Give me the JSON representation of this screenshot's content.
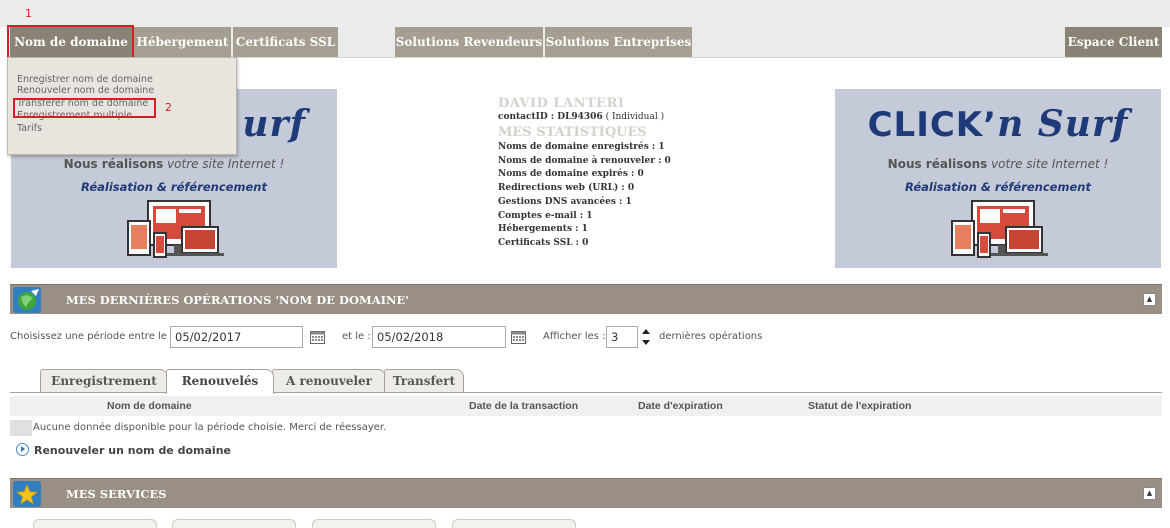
{
  "annotations": {
    "marker1": "1",
    "marker2": "2"
  },
  "nav": {
    "domain": "Nom de domaine",
    "hosting": "Hébergement",
    "ssl": "Certificats SSL",
    "resellers": "Solutions Revendeurs",
    "enterprise": "Solutions Entreprises",
    "client": "Espace Client"
  },
  "dropdown": {
    "items": [
      "Enregistrer nom de domaine",
      "Renouveler nom de domaine",
      "Transférer nom de domaine",
      "Enregistrement multiple",
      "Tarifs"
    ]
  },
  "banner": {
    "brand_main": "CLICK",
    "brand_apos": "’",
    "brand_italic": "n Surf",
    "tagline_bold": "Nous réalisons",
    "tagline_italic": " votre site Internet !",
    "subtag": "Réalisation & référencement",
    "left_visible_fragment": "urf"
  },
  "stats": {
    "name": "DAVID LANTERI",
    "contact_label": "contactID : ",
    "contact_id": "DL94306",
    "contact_type": " ( Individual )",
    "heading": "MES STATISTIQUES",
    "lines": [
      "Noms de domaine enregistrés : 1",
      "Noms de domaine à renouveler : 0",
      "Noms de domaine expirés : 0",
      "Redirections web (URL) : 0",
      "Gestions DNS avancées : 1",
      "Comptes e-mail : 1",
      "Hébergements : 1",
      "Certificats SSL : 0"
    ]
  },
  "operations": {
    "title": "MES DERNIÈRES OPÉRATIONS 'NOM DE DOMAINE'",
    "collapse_glyph": "▲",
    "period_label": "Choisissez une période entre le :",
    "date_from": "05/02/2017",
    "and_label": "et le :",
    "date_to": "05/02/2018",
    "show_label": "Afficher les :",
    "count": "3",
    "last_ops_label": "dernières opérations",
    "tabs": [
      "Enregistrement",
      "Renouvelés",
      "A renouveler",
      "Transfert"
    ],
    "active_tab": "Renouvelés",
    "columns": [
      "Nom de domaine",
      "Date de la transaction",
      "Date d'expiration",
      "Statut de l'expiration"
    ],
    "empty_message": "Aucune donnée disponible pour la période choisie. Merci de réessayer.",
    "renew_link": "Renouveler un nom de domaine"
  },
  "services": {
    "title": "MES SERVICES",
    "collapse_glyph": "▲"
  }
}
